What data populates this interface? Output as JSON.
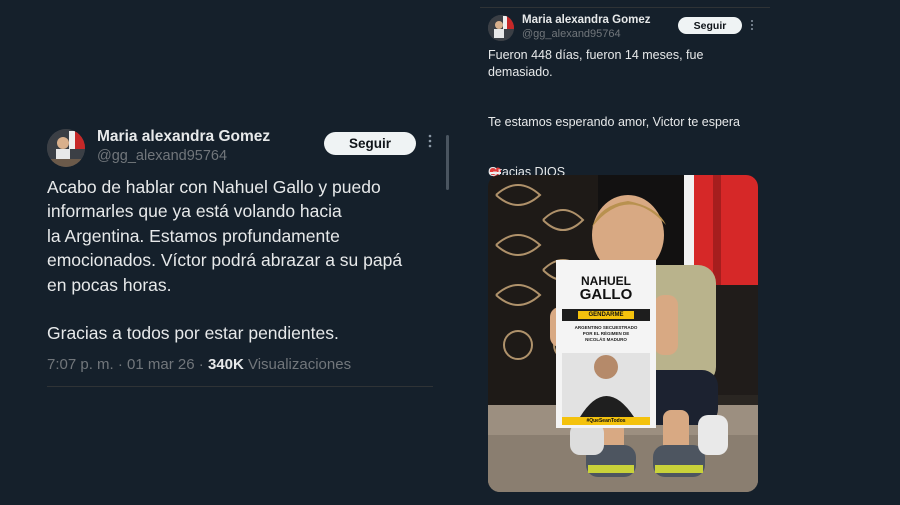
{
  "left_tweet": {
    "author_name": "Maria alexandra Gomez",
    "author_handle": "@gg_alexand95764",
    "follow_label": "Seguir",
    "text": "Acabo de hablar con Nahuel Gallo y puedo\ninformarles que ya está volando hacia\nla Argentina. Estamos profundamente\nemocionados. Víctor podrá abrazar a su papá\nen pocas horas.\n\nGracias a todos por estar pendientes.",
    "time": "7:07 p. m.",
    "date": "01 mar 26",
    "views_count": "340K",
    "views_label": "Visualizaciones"
  },
  "right_tweet": {
    "author_name": "Maria alexandra Gomez",
    "author_handle": "@gg_alexand95764",
    "follow_label": "Seguir",
    "text_1": "Fueron 448 días, fueron 14 meses, fue\ndemasiado.",
    "text_2": "Te estamos esperando amor, Victor te espera",
    "text_3": "Gracias DIOS",
    "photo": {
      "sign_name_1": "NAHUEL",
      "sign_name_2": "GALLO",
      "sign_role": "GENDARME",
      "sign_caption": "ARGENTINO SECUESTRADO\nPOR EL RÉGIMEN DE\nNICOLÁS MADURO",
      "sign_hashtag": "#QueSeanTodos"
    }
  },
  "colors": {
    "background": "#15202b",
    "flag_red": "#d62828",
    "flag_white": "#f2f2f2",
    "sign_yellow": "#f4c20d"
  }
}
